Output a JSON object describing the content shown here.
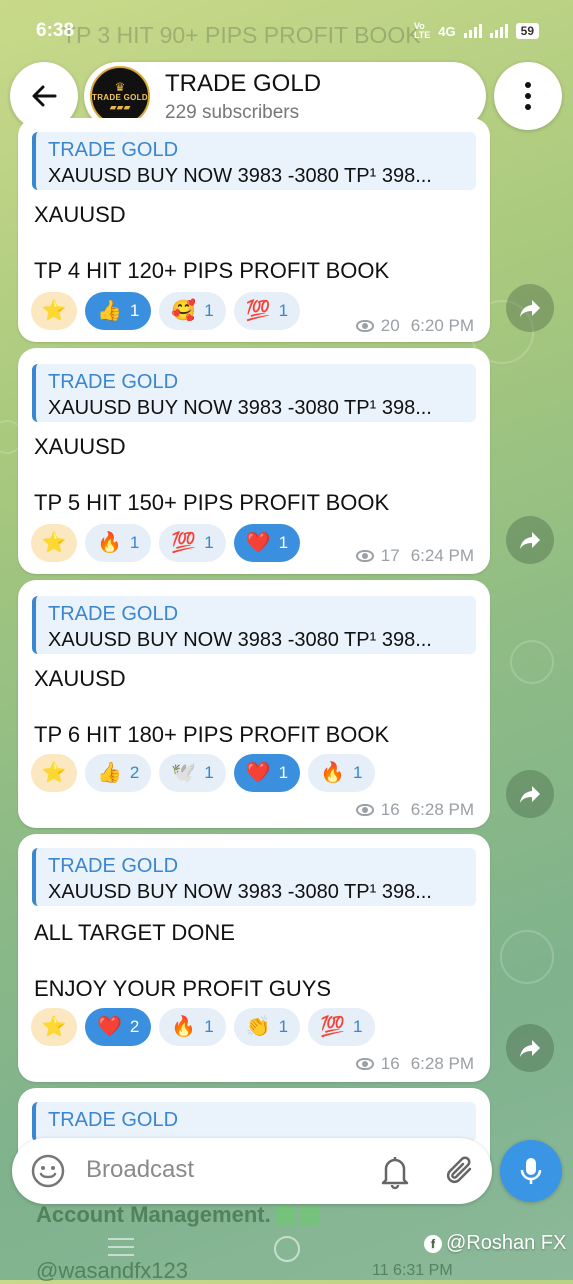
{
  "status_bar": {
    "time": "6:38",
    "ghost_title": "TP 3 HIT 90+ PIPS PROFIT BOOK",
    "network": "4G",
    "battery": "59"
  },
  "header": {
    "title": "TRADE GOLD",
    "subtitle": "229 subscribers",
    "avatar_text": "TRADE GOLD"
  },
  "messages": [
    {
      "reply_name": "TRADE GOLD",
      "reply_text": "XAUUSD  BUY NOW 3983 -3080   TP¹  398...",
      "line1": "XAUUSD",
      "line2": "TP 4 HIT 120+ PIPS PROFIT BOOK",
      "reactions": [
        {
          "emoji": "⭐",
          "count": ""
        },
        {
          "emoji": "👍",
          "count": "1"
        },
        {
          "emoji": "🥰",
          "count": "1"
        },
        {
          "emoji": "💯",
          "count": "1"
        }
      ],
      "views": "20",
      "time": "6:20 PM"
    },
    {
      "reply_name": "TRADE GOLD",
      "reply_text": "XAUUSD  BUY NOW 3983 -3080   TP¹  398...",
      "line1": "XAUUSD",
      "line2": "TP 5 HIT 150+ PIPS PROFIT BOOK",
      "reactions": [
        {
          "emoji": "⭐",
          "count": ""
        },
        {
          "emoji": "🔥",
          "count": "1"
        },
        {
          "emoji": "💯",
          "count": "1"
        },
        {
          "emoji": "❤️",
          "count": "1"
        }
      ],
      "views": "17",
      "time": "6:24 PM"
    },
    {
      "reply_name": "TRADE GOLD",
      "reply_text": "XAUUSD  BUY NOW 3983 -3080   TP¹  398...",
      "line1": "XAUUSD",
      "line2": "TP 6 HIT 180+ PIPS PROFIT BOOK",
      "reactions": [
        {
          "emoji": "⭐",
          "count": ""
        },
        {
          "emoji": "👍",
          "count": "2"
        },
        {
          "emoji": "🕊️",
          "count": "1"
        },
        {
          "emoji": "❤️",
          "count": "1"
        },
        {
          "emoji": "🔥",
          "count": "1"
        }
      ],
      "views": "16",
      "time": "6:28 PM"
    },
    {
      "reply_name": "TRADE GOLD",
      "reply_text": "XAUUSD  BUY NOW 3983 -3080   TP¹  398...",
      "line1": "ALL TARGET DONE",
      "line2": " ENJOY YOUR PROFIT GUYS",
      "reactions": [
        {
          "emoji": "⭐",
          "count": ""
        },
        {
          "emoji": "❤️",
          "count": "2"
        },
        {
          "emoji": "🔥",
          "count": "1"
        },
        {
          "emoji": "👏",
          "count": "1"
        },
        {
          "emoji": "💯",
          "count": "1"
        }
      ],
      "views": "16",
      "time": "6:28 PM"
    },
    {
      "reply_name": "TRADE GOLD"
    }
  ],
  "under_input": {
    "line1": "Account Management.",
    "line2": "@wasandfx123",
    "meta": "11  6:31 PM"
  },
  "input": {
    "placeholder": "Broadcast"
  },
  "watermark": "@Roshan FX"
}
